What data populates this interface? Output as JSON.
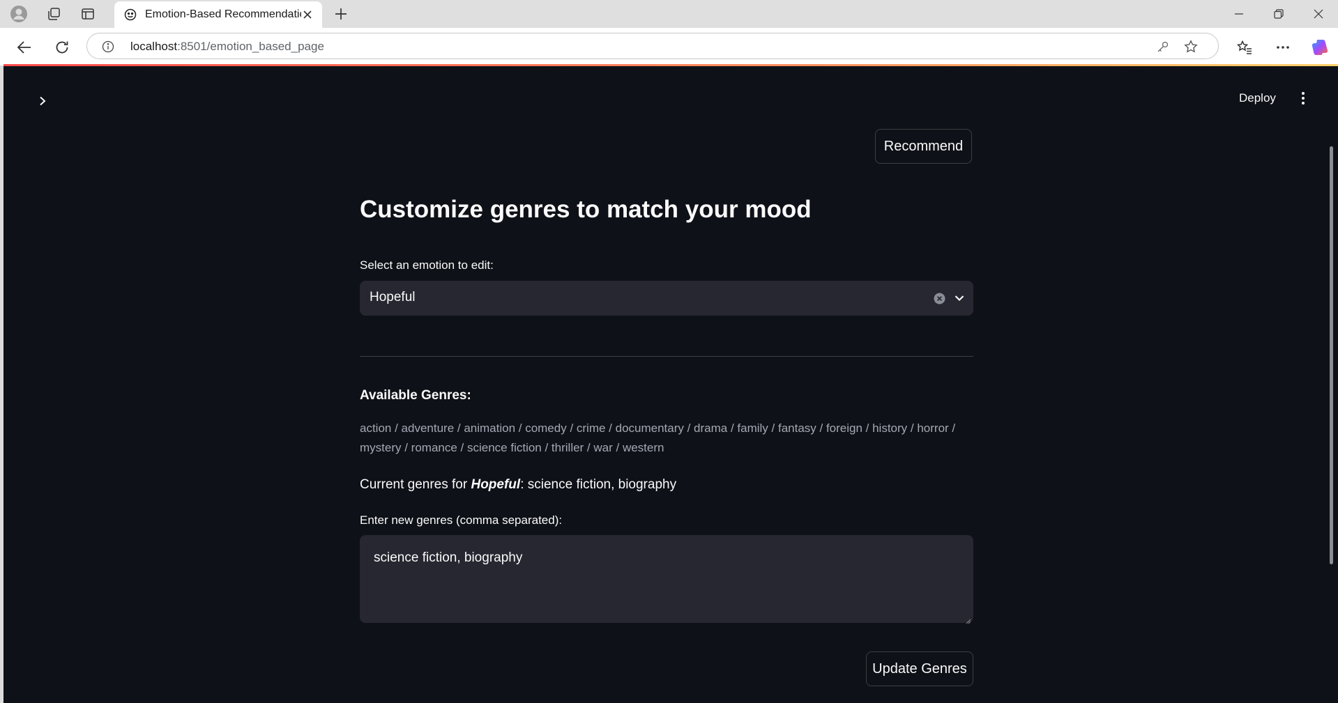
{
  "browser": {
    "tab_title": "Emotion-Based Recommendation",
    "url_host": "localhost",
    "url_path": ":8501/emotion_based_page"
  },
  "app": {
    "deploy_label": "Deploy",
    "recommend_label": "Recommend",
    "page_title": "Customize genres to match your mood",
    "emotion_select": {
      "label": "Select an emotion to edit:",
      "value": "Hopeful"
    },
    "available_genres_heading": "Available Genres:",
    "available_genres_text": "action / adventure / animation / comedy / crime / documentary / drama / family / fantasy / foreign / history / horror / mystery / romance / science fiction / thriller / war / western",
    "current_genres": {
      "prefix": "Current genres for ",
      "emotion": "Hopeful",
      "suffix": ": science fiction, biography"
    },
    "new_genres": {
      "label": "Enter new genres (comma separated):",
      "value": "science fiction, biography"
    },
    "update_label": "Update Genres"
  },
  "colors": {
    "app_bg": "#0e1117",
    "input_bg": "#262730",
    "text": "#fafafa",
    "muted_text": "#a3a8b4",
    "accent_gradient_start": "#ff4b4b",
    "accent_gradient_end": "#ffd16a"
  }
}
